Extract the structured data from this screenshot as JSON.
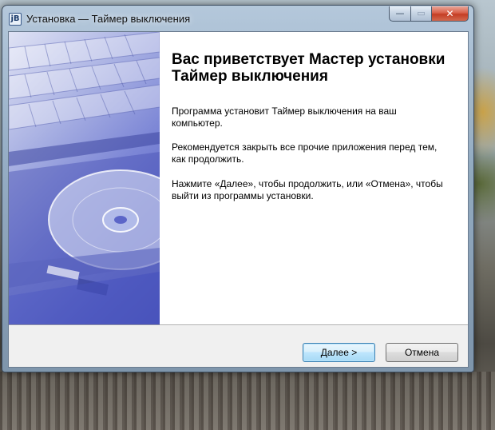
{
  "window": {
    "title": "Установка — Таймер выключения",
    "icon_text": "jB",
    "minimize_glyph": "—",
    "maximize_glyph": "▭",
    "close_glyph": "✕"
  },
  "wizard": {
    "heading": "Вас приветствует Мастер установки Таймер выключения",
    "paragraph_1": "Программа установит Таймер выключения на ваш компьютер.",
    "paragraph_2": "Рекомендуется закрыть все прочие приложения перед тем, как продолжить.",
    "paragraph_3": "Нажмите «Далее», чтобы продолжить, или «Отмена», чтобы выйти из программы установки."
  },
  "buttons": {
    "next_label": "Далее >",
    "cancel_label": "Отмена"
  },
  "icons": {
    "app": "installer-app-icon",
    "side_image": "laptop-cd-drive-illustration"
  },
  "colors": {
    "side_image_accent": "#5c66c8",
    "default_button_border": "#3c7fb1",
    "close_button": "#c43d24"
  }
}
